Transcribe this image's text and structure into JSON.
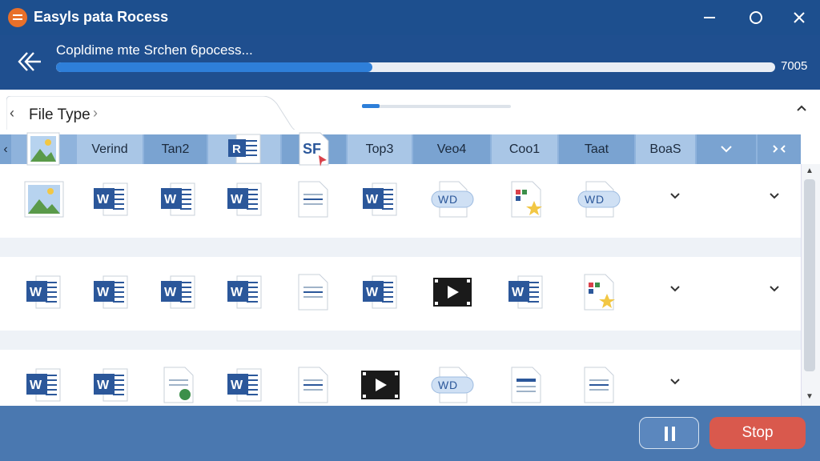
{
  "window": {
    "title": "Easyls pata Rocess",
    "controls": [
      "minimize-icon",
      "maximize-icon",
      "close-icon"
    ]
  },
  "progress": {
    "label": "Copldime mte Srchen 6pocess...",
    "percent": 44,
    "value_text": "7005"
  },
  "filetype_bar": {
    "label": "File Type"
  },
  "columns": {
    "headers": [
      "Verind",
      "Tan2",
      "R",
      "SF",
      "Top3",
      "Veo4",
      "Coo1",
      "Taat",
      "BoaS"
    ]
  },
  "rows": [
    [
      "image-icon",
      "word-icon",
      "word-icon",
      "word-icon",
      "doc-text-icon",
      "word-icon",
      "wid-badge-icon",
      "star-doc-icon",
      "wid-badge-icon"
    ],
    [
      "word-icon",
      "word-icon",
      "word-icon",
      "word-icon",
      "doc-text-icon",
      "word-icon",
      "video-icon",
      "word-icon",
      "star-doc-icon"
    ],
    [
      "word-icon",
      "word-icon",
      "sheet-icon",
      "word-icon",
      "doc-text-icon",
      "video-icon",
      "wid-badge-icon",
      "doc-lines-icon",
      "doc-text-icon"
    ]
  ],
  "footer": {
    "stop_label": "Stop"
  },
  "colors": {
    "title_bg": "#1d4f8e",
    "progress_fill": "#2e7fd9",
    "stop_bg": "#d9594d",
    "word_blue": "#2b579a"
  }
}
